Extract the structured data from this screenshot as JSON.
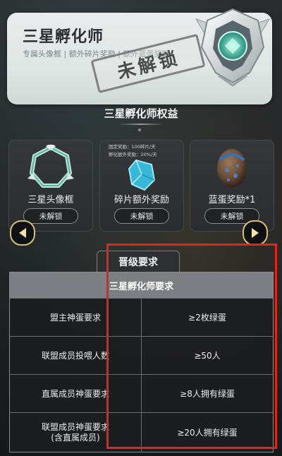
{
  "header": {
    "title": "三星孵化师",
    "subtitle": "专属头像框 | 额外碎片奖励 | 额外蓝蛋奖励",
    "stamp": "未解锁"
  },
  "benefits": {
    "title": "三星孵化师权益",
    "cards": [
      {
        "name": "三星头像框",
        "button": "未解锁",
        "icon": "avatar-frame-icon"
      },
      {
        "name": "碎片额外奖励",
        "button": "未解锁",
        "icon": "crystal-shard-icon",
        "details": [
          "固定奖励：100碎片/天",
          "孵化额外奖励：20%/天"
        ]
      },
      {
        "name": "蓝蛋奖励*1",
        "button": "未解锁",
        "icon": "blue-egg-icon"
      }
    ]
  },
  "nav": {
    "prev": "prev-arrow-icon",
    "next": "next-arrow-icon"
  },
  "requirements": {
    "tab": "晋级要求",
    "table_title": "三星孵化师要求",
    "rows": [
      {
        "label": "盟主神蛋要求",
        "value": "≥2枚绿蛋"
      },
      {
        "label": "联盟成员投喂人数",
        "value": "≥50人"
      },
      {
        "label": "直属成员神蛋要求",
        "value": "≥8人拥有绿蛋"
      },
      {
        "label": "联盟成员神蛋要求\n(含直属成员)",
        "value": "≥20人拥有绿蛋"
      }
    ]
  },
  "colors": {
    "highlight": "#e1251b",
    "arrow_border": "#d8c176",
    "table_header": "#7b7e82"
  }
}
